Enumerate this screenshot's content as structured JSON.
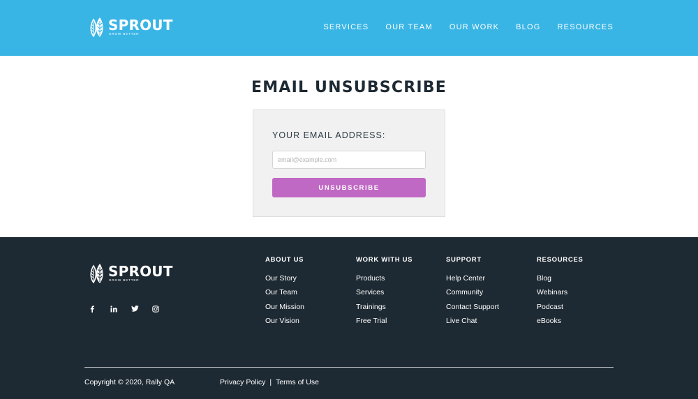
{
  "brand": {
    "name": "SPROUT",
    "tagline": "GROW BETTER"
  },
  "nav": [
    "SERVICES",
    "OUR TEAM",
    "OUR WORK",
    "BLOG",
    "RESOURCES"
  ],
  "main": {
    "title": "EMAIL UNSUBSCRIBE",
    "email_label": "YOUR EMAIL ADDRESS:",
    "email_placeholder": "email@example.com",
    "email_value": "",
    "button_label": "UNSUBSCRIBE"
  },
  "footer": {
    "social": [
      "facebook-icon",
      "linkedin-icon",
      "twitter-icon",
      "instagram-icon"
    ],
    "columns": [
      {
        "heading": "ABOUT US",
        "links": [
          "Our Story",
          "Our Team",
          "Our Mission",
          "Our Vision"
        ]
      },
      {
        "heading": "WORK WITH US",
        "links": [
          "Products",
          "Services",
          "Trainings",
          "Free Trial"
        ]
      },
      {
        "heading": "SUPPORT",
        "links": [
          "Help Center",
          "Community",
          "Contact Support",
          "Live Chat"
        ]
      },
      {
        "heading": "RESOURCES",
        "links": [
          "Blog",
          "Webinars",
          "Podcast",
          "eBooks"
        ]
      }
    ],
    "copyright": "Copyright © 2020, Rally QA",
    "privacy": "Privacy Policy",
    "separator": "|",
    "terms": "Terms of Use"
  },
  "colors": {
    "header_bg": "#39b5e5",
    "footer_bg": "#1e2a33",
    "button_bg": "#c069c4",
    "card_bg": "#f1f1f1"
  }
}
